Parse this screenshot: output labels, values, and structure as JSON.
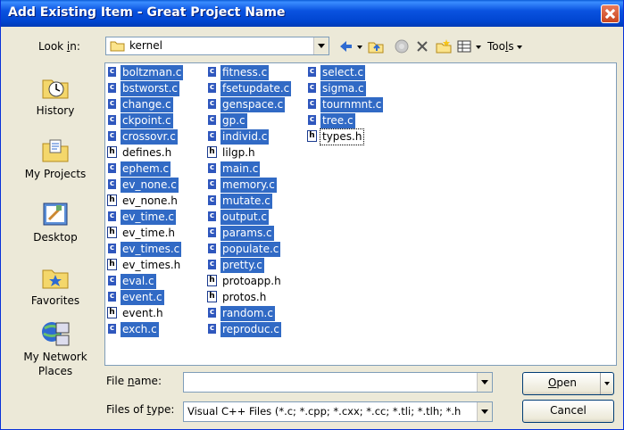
{
  "window": {
    "title": "Add Existing Item - Great Project Name"
  },
  "toolbar": {
    "lookin_label_pre": "Look ",
    "lookin_label_u": "i",
    "lookin_label_post": "n:",
    "lookin_value": "kernel",
    "tools_label_pre": "Too",
    "tools_label_u": "l",
    "tools_label_post": "s"
  },
  "places": [
    {
      "label": "History",
      "icon": "history-icon"
    },
    {
      "label": "My Projects",
      "icon": "my-projects-icon"
    },
    {
      "label": "Desktop",
      "icon": "desktop-icon"
    },
    {
      "label": "Favorites",
      "icon": "favorites-icon"
    },
    {
      "label": "My Network Places",
      "icon": "network-places-icon"
    }
  ],
  "files": {
    "column1": [
      {
        "name": "boltzman.c",
        "type": "c",
        "selected": true
      },
      {
        "name": "bstworst.c",
        "type": "c",
        "selected": true
      },
      {
        "name": "change.c",
        "type": "c",
        "selected": true
      },
      {
        "name": "ckpoint.c",
        "type": "c",
        "selected": true
      },
      {
        "name": "crossovr.c",
        "type": "c",
        "selected": true
      },
      {
        "name": "defines.h",
        "type": "h",
        "selected": false
      },
      {
        "name": "ephem.c",
        "type": "c",
        "selected": true
      },
      {
        "name": "ev_none.c",
        "type": "c",
        "selected": true
      },
      {
        "name": "ev_none.h",
        "type": "h",
        "selected": false
      },
      {
        "name": "ev_time.c",
        "type": "c",
        "selected": true
      },
      {
        "name": "ev_time.h",
        "type": "h",
        "selected": false
      },
      {
        "name": "ev_times.c",
        "type": "c",
        "selected": true
      },
      {
        "name": "ev_times.h",
        "type": "h",
        "selected": false
      },
      {
        "name": "eval.c",
        "type": "c",
        "selected": true
      },
      {
        "name": "event.c",
        "type": "c",
        "selected": true
      },
      {
        "name": "event.h",
        "type": "h",
        "selected": false
      },
      {
        "name": "exch.c",
        "type": "c",
        "selected": true
      }
    ],
    "column2": [
      {
        "name": "fitness.c",
        "type": "c",
        "selected": true
      },
      {
        "name": "fsetupdate.c",
        "type": "c",
        "selected": true
      },
      {
        "name": "genspace.c",
        "type": "c",
        "selected": true
      },
      {
        "name": "gp.c",
        "type": "c",
        "selected": true
      },
      {
        "name": "individ.c",
        "type": "c",
        "selected": true
      },
      {
        "name": "lilgp.h",
        "type": "h",
        "selected": false
      },
      {
        "name": "main.c",
        "type": "c",
        "selected": true
      },
      {
        "name": "memory.c",
        "type": "c",
        "selected": true
      },
      {
        "name": "mutate.c",
        "type": "c",
        "selected": true
      },
      {
        "name": "output.c",
        "type": "c",
        "selected": true
      },
      {
        "name": "params.c",
        "type": "c",
        "selected": true
      },
      {
        "name": "populate.c",
        "type": "c",
        "selected": true
      },
      {
        "name": "pretty.c",
        "type": "c",
        "selected": true
      },
      {
        "name": "protoapp.h",
        "type": "h",
        "selected": false
      },
      {
        "name": "protos.h",
        "type": "h",
        "selected": false
      },
      {
        "name": "random.c",
        "type": "c",
        "selected": true
      },
      {
        "name": "reproduc.c",
        "type": "c",
        "selected": true
      }
    ],
    "column3": [
      {
        "name": "select.c",
        "type": "c",
        "selected": true
      },
      {
        "name": "sigma.c",
        "type": "c",
        "selected": true
      },
      {
        "name": "tournmnt.c",
        "type": "c",
        "selected": true
      },
      {
        "name": "tree.c",
        "type": "c",
        "selected": true
      },
      {
        "name": "types.h",
        "type": "h",
        "selected": false,
        "focused": true
      }
    ]
  },
  "form": {
    "filename_label_pre": "File ",
    "filename_label_u": "n",
    "filename_label_post": "ame:",
    "filename_value": "",
    "filetype_label_pre": "Files of ",
    "filetype_label_u": "t",
    "filetype_label_post": "ype:",
    "filetype_value": "Visual C++ Files (*.c; *.cpp; *.cxx; *.cc; *.tli; *.tlh; *.h"
  },
  "buttons": {
    "open_u": "O",
    "open_rest": "pen",
    "cancel": "Cancel"
  }
}
